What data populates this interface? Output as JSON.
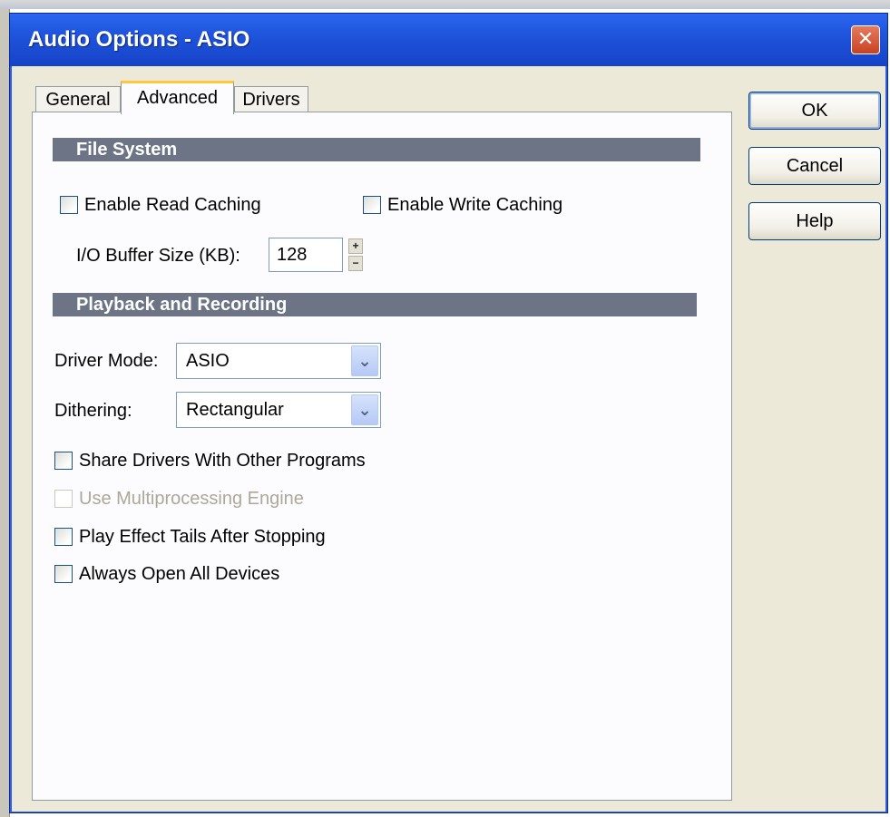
{
  "window": {
    "title": "Audio Options - ASIO",
    "close_glyph": "✕"
  },
  "tabs": [
    {
      "label": "General",
      "active": false
    },
    {
      "label": "Advanced",
      "active": true
    },
    {
      "label": "Drivers",
      "active": false
    }
  ],
  "file_system": {
    "heading": "File System",
    "enable_read_caching": {
      "label": "Enable Read Caching",
      "checked": false
    },
    "enable_write_caching": {
      "label": "Enable Write Caching",
      "checked": false
    },
    "io_buffer": {
      "label": "I/O Buffer Size (KB):",
      "value": "128",
      "up": "+",
      "down": "−"
    }
  },
  "playback": {
    "heading": "Playback and Recording",
    "driver_mode": {
      "label": "Driver Mode:",
      "value": "ASIO"
    },
    "dithering": {
      "label": "Dithering:",
      "value": "Rectangular"
    },
    "options": [
      {
        "label": "Share Drivers With Other Programs",
        "checked": false,
        "enabled": true
      },
      {
        "label": "Use Multiprocessing Engine",
        "checked": false,
        "enabled": false
      },
      {
        "label": "Play Effect Tails After Stopping",
        "checked": false,
        "enabled": true
      },
      {
        "label": "Always Open All Devices",
        "checked": false,
        "enabled": true
      }
    ]
  },
  "buttons": {
    "ok": "OK",
    "cancel": "Cancel",
    "help": "Help"
  },
  "icons": {
    "dropdown_arrow": "chevron-down-icon",
    "close": "close-icon"
  },
  "colors": {
    "titlebar": "#1f54dc",
    "section_bar": "#6c7486",
    "dialog_bg": "#ece9d8",
    "active_tab_accent": "#ffc83c"
  }
}
